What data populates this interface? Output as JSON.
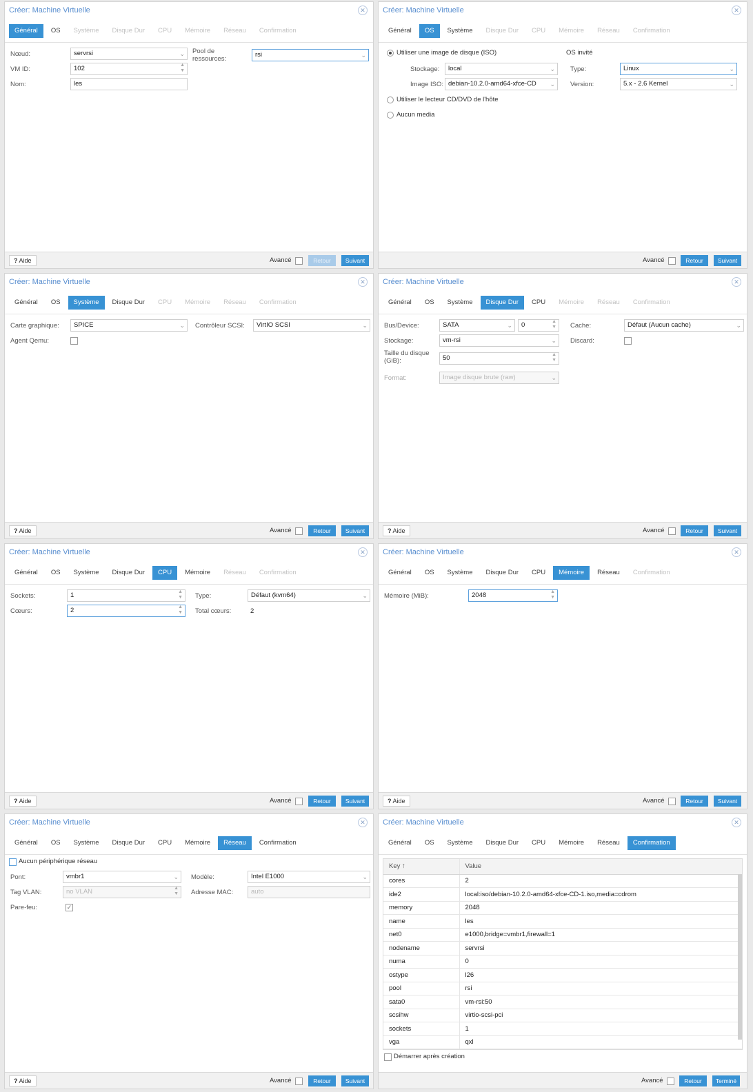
{
  "dialog_title": "Créer: Machine Virtuelle",
  "tabs": [
    "Général",
    "OS",
    "Système",
    "Disque Dur",
    "CPU",
    "Mémoire",
    "Réseau",
    "Confirmation"
  ],
  "footer": {
    "help": "Aide",
    "advanced": "Avancé",
    "back": "Retour",
    "next": "Suivant",
    "finish": "Terminé"
  },
  "general": {
    "node_label": "Nœud:",
    "node_value": "servrsi",
    "vmid_label": "VM ID:",
    "vmid_value": "102",
    "name_label": "Nom:",
    "name_value": "les",
    "pool_label": "Pool de ressources:",
    "pool_value": "rsi"
  },
  "os": {
    "use_iso": "Utiliser une image de disque (ISO)",
    "storage_label": "Stockage:",
    "storage_value": "local",
    "iso_label": "Image ISO:",
    "iso_value": "debian-10.2.0-amd64-xfce-CD",
    "use_cdrom": "Utiliser le lecteur CD/DVD de l'hôte",
    "no_media": "Aucun media",
    "guest_os": "OS invité",
    "type_label": "Type:",
    "type_value": "Linux",
    "version_label": "Version:",
    "version_value": "5.x - 2.6 Kernel"
  },
  "system": {
    "graphic_label": "Carte graphique:",
    "graphic_value": "SPICE",
    "agent_label": "Agent Qemu:",
    "scsi_label": "Contrôleur SCSI:",
    "scsi_value": "VirtIO SCSI"
  },
  "disk": {
    "bus_label": "Bus/Device:",
    "bus_value": "SATA",
    "device_value": "0",
    "storage_label": "Stockage:",
    "storage_value": "vm-rsi",
    "size_label": "Taille du disque (GiB):",
    "size_value": "50",
    "format_label": "Format:",
    "format_value": "Image disque brute (raw)",
    "cache_label": "Cache:",
    "cache_value": "Défaut (Aucun cache)",
    "discard_label": "Discard:"
  },
  "cpu": {
    "sockets_label": "Sockets:",
    "sockets_value": "1",
    "cores_label": "Cœurs:",
    "cores_value": "2",
    "type_label": "Type:",
    "type_value": "Défaut (kvm64)",
    "total_label": "Total cœurs:",
    "total_value": "2"
  },
  "memory": {
    "label": "Mémoire (MiB):",
    "value": "2048"
  },
  "network": {
    "no_device": "Aucun périphérique réseau",
    "bridge_label": "Pont:",
    "bridge_value": "vmbr1",
    "vlan_label": "Tag VLAN:",
    "vlan_value": "no VLAN",
    "firewall_label": "Pare-feu:",
    "model_label": "Modèle:",
    "model_value": "Intel E1000",
    "mac_label": "Adresse MAC:",
    "mac_value": "auto"
  },
  "confirm": {
    "col_key": "Key ↑",
    "col_value": "Value",
    "rows": [
      [
        "cores",
        "2"
      ],
      [
        "ide2",
        "local:iso/debian-10.2.0-amd64-xfce-CD-1.iso,media=cdrom"
      ],
      [
        "memory",
        "2048"
      ],
      [
        "name",
        "les"
      ],
      [
        "net0",
        "e1000,bridge=vmbr1,firewall=1"
      ],
      [
        "nodename",
        "servrsi"
      ],
      [
        "numa",
        "0"
      ],
      [
        "ostype",
        "l26"
      ],
      [
        "pool",
        "rsi"
      ],
      [
        "sata0",
        "vm-rsi:50"
      ],
      [
        "scsihw",
        "virtio-scsi-pci"
      ],
      [
        "sockets",
        "1"
      ],
      [
        "vga",
        "qxl"
      ]
    ],
    "start_after": "Démarrer après création"
  }
}
